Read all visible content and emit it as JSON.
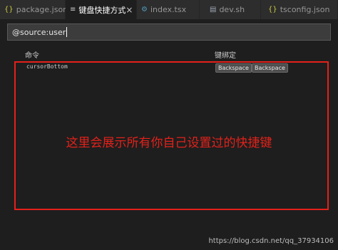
{
  "tabs": [
    {
      "icon": "{}",
      "label": "package.json",
      "active": false
    },
    {
      "icon": "≡",
      "label": "键盘快捷方式",
      "active": true
    },
    {
      "icon": "⚙",
      "label": "index.tsx",
      "active": false
    },
    {
      "icon": "▤",
      "label": "dev.sh",
      "active": false
    },
    {
      "icon": "{}",
      "label": "tsconfig.json",
      "active": false
    }
  ],
  "search": {
    "value": "@source:user"
  },
  "table": {
    "header": {
      "command": "命令",
      "keybinding": "键绑定"
    },
    "rows": [
      {
        "command": "cursorBottom",
        "keys": [
          "Backspace",
          "Backspace"
        ]
      }
    ]
  },
  "annotation": {
    "text": "这里会展示所有你自己设置过的快捷键",
    "color": "#e3211a"
  },
  "watermark": "https://blog.csdn.net/qq_37934106"
}
